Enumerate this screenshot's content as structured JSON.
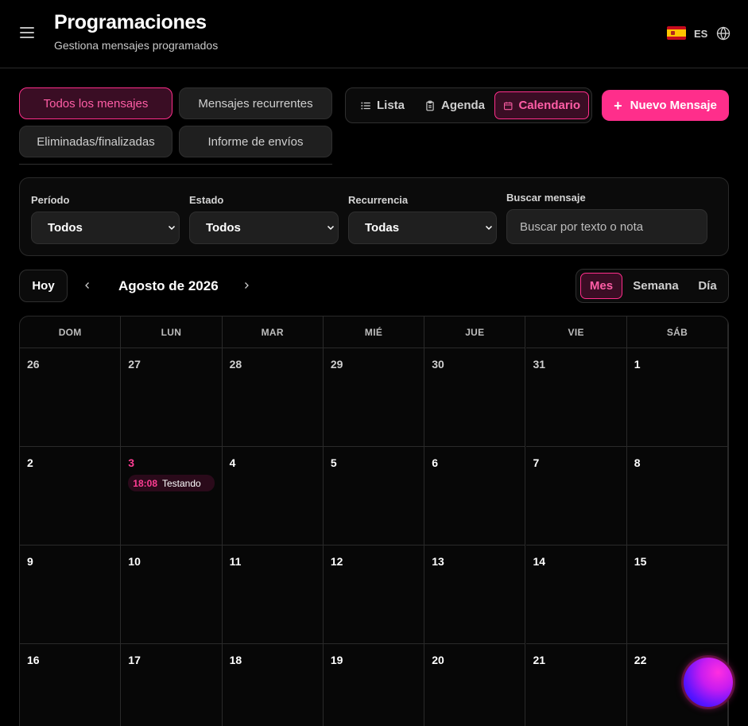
{
  "header": {
    "title": "Programaciones",
    "subtitle": "Gestiona mensajes programados",
    "language": "ES"
  },
  "tabs": [
    {
      "label": "Todos los mensajes",
      "active": true
    },
    {
      "label": "Mensajes recurrentes",
      "active": false
    },
    {
      "label": "Eliminadas/finalizadas",
      "active": false
    },
    {
      "label": "Informe de envíos",
      "active": false
    }
  ],
  "view_toggle": [
    {
      "label": "Lista",
      "icon": "list-icon",
      "active": false
    },
    {
      "label": "Agenda",
      "icon": "clipboard-icon",
      "active": false
    },
    {
      "label": "Calendario",
      "icon": "calendar-icon",
      "active": true
    }
  ],
  "new_message": {
    "label": "Nuevo Mensaje"
  },
  "filters": {
    "period": {
      "label": "Período",
      "value": "Todos"
    },
    "status": {
      "label": "Estado",
      "value": "Todos"
    },
    "recurrence": {
      "label": "Recurrencia",
      "value": "Todas"
    },
    "search": {
      "label": "Buscar mensaje",
      "placeholder": "Buscar por texto o nota"
    }
  },
  "calendar_nav": {
    "today_label": "Hoy",
    "month_label": "Agosto de 2026",
    "ranges": [
      {
        "label": "Mes",
        "active": true
      },
      {
        "label": "Semana",
        "active": false
      },
      {
        "label": "Día",
        "active": false
      }
    ]
  },
  "calendar": {
    "weekdays": [
      "DOM",
      "LUN",
      "MAR",
      "MIÉ",
      "JUE",
      "VIE",
      "SÁB"
    ],
    "weeks": [
      [
        {
          "day": "26",
          "other": true
        },
        {
          "day": "27",
          "other": true
        },
        {
          "day": "28",
          "other": true
        },
        {
          "day": "29",
          "other": true
        },
        {
          "day": "30",
          "other": true
        },
        {
          "day": "31",
          "other": true
        },
        {
          "day": "1"
        }
      ],
      [
        {
          "day": "2"
        },
        {
          "day": "3",
          "today": true,
          "event": {
            "time": "18:08",
            "title": "Testando"
          }
        },
        {
          "day": "4"
        },
        {
          "day": "5"
        },
        {
          "day": "6"
        },
        {
          "day": "7"
        },
        {
          "day": "8"
        }
      ],
      [
        {
          "day": "9"
        },
        {
          "day": "10"
        },
        {
          "day": "11"
        },
        {
          "day": "12"
        },
        {
          "day": "13"
        },
        {
          "day": "14"
        },
        {
          "day": "15"
        }
      ],
      [
        {
          "day": "16"
        },
        {
          "day": "17"
        },
        {
          "day": "18"
        },
        {
          "day": "19"
        },
        {
          "day": "20"
        },
        {
          "day": "21"
        },
        {
          "day": "22"
        }
      ]
    ]
  },
  "colors": {
    "accent": "#ff2e8b",
    "accent_text": "#ff5ea6",
    "background": "#000000",
    "surface": "#1f1f1f"
  }
}
